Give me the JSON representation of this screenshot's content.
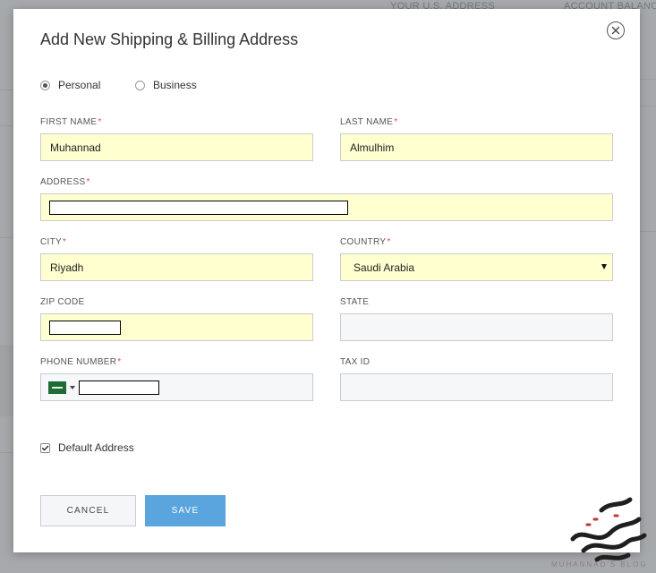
{
  "modal": {
    "title": "Add New Shipping & Billing Address",
    "close_icon": "close-icon"
  },
  "account_type": {
    "options": [
      {
        "label": "Personal",
        "selected": true
      },
      {
        "label": "Business",
        "selected": false
      }
    ]
  },
  "fields": {
    "first_name": {
      "label": "FIRST NAME",
      "required": true,
      "value": "Muhannad"
    },
    "last_name": {
      "label": "LAST NAME",
      "required": true,
      "value": "Almulhim"
    },
    "address": {
      "label": "ADDRESS",
      "required": true,
      "value": ""
    },
    "city": {
      "label": "CITY",
      "required": true,
      "value": "Riyadh"
    },
    "country": {
      "label": "COUNTRY",
      "required": true,
      "value": "Saudi Arabia"
    },
    "zip_code": {
      "label": "ZIP CODE",
      "required": false,
      "value": ""
    },
    "state": {
      "label": "STATE",
      "required": false,
      "value": ""
    },
    "phone_number": {
      "label": "PHONE NUMBER",
      "required": true,
      "value": "",
      "flag_icon": "saudi-arabia-flag-icon"
    },
    "tax_id": {
      "label": "TAX ID",
      "required": false,
      "value": ""
    }
  },
  "required_marker": "*",
  "default_address": {
    "label": "Default Address",
    "checked": true
  },
  "buttons": {
    "cancel": "CANCEL",
    "save": "SAVE"
  },
  "background": {
    "your_us_address": "YOUR U.S. ADDRESS",
    "account_balance": "ACCOUNT BALANC"
  },
  "watermark": {
    "caption": "MUHANNAD'S BLOG"
  },
  "colors": {
    "autofill": "#ffffd0",
    "save_button": "#5aa5dd",
    "required": "#d9534f",
    "flag": "#1e6b35"
  }
}
